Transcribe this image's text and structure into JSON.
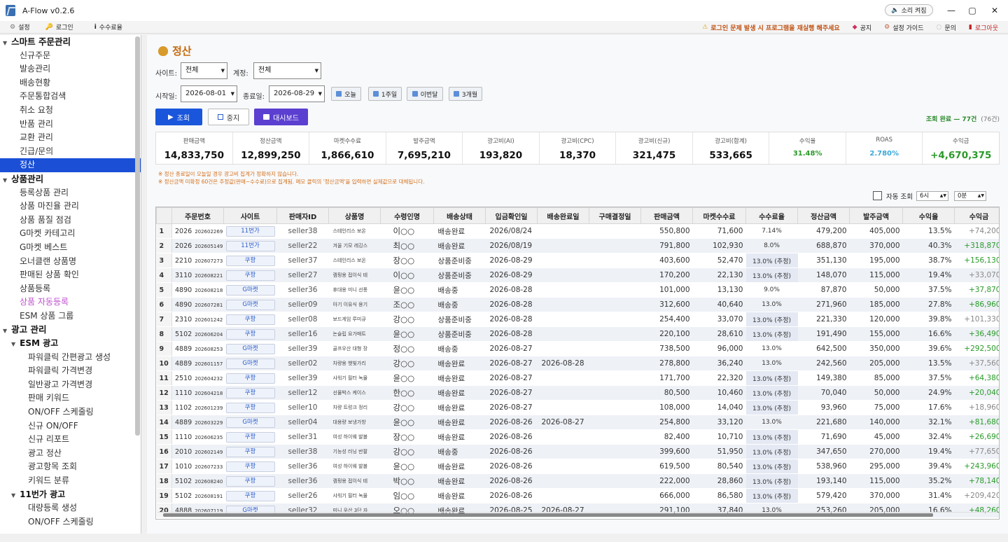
{
  "app": {
    "title": "A-Flow v0.2.6",
    "sound_label": "소리 켜짐"
  },
  "menubar": {
    "left": [
      {
        "icon": "gear-icon",
        "label": "설정"
      },
      {
        "icon": "key-icon",
        "label": "로그인"
      },
      {
        "icon": "info-icon",
        "label": "수수료율"
      }
    ],
    "right": [
      {
        "icon": "warning-icon",
        "label": "로그인 문제 발생 시 프로그램을 재실행 해주세요"
      },
      {
        "icon": "notice-icon",
        "label": "공지"
      },
      {
        "icon": "guide-icon",
        "label": "설정 가이드"
      },
      {
        "icon": "chat-icon",
        "label": "문의"
      },
      {
        "icon": "logout-icon",
        "label": "로그아웃"
      }
    ]
  },
  "sidebar": [
    {
      "level": "h1",
      "label": "스마트 주문관리"
    },
    {
      "level": "l1",
      "label": "신규주문"
    },
    {
      "level": "l1",
      "label": "발송관리"
    },
    {
      "level": "l1",
      "label": "배송현황"
    },
    {
      "level": "l1",
      "label": "주문통합검색"
    },
    {
      "level": "l1",
      "label": "취소 요청"
    },
    {
      "level": "l1",
      "label": "반품 관리"
    },
    {
      "level": "l1",
      "label": "교환 관리"
    },
    {
      "level": "l1",
      "label": "긴급/문의"
    },
    {
      "level": "l1",
      "label": "정산",
      "active": true
    },
    {
      "level": "h1",
      "label": "상품관리"
    },
    {
      "level": "l1",
      "label": "등록상품 관리"
    },
    {
      "level": "l1",
      "label": "상품 마진율 관리"
    },
    {
      "level": "l1",
      "label": "상품 품질 점검"
    },
    {
      "level": "l1",
      "label": "G마켓 카테고리"
    },
    {
      "level": "l1",
      "label": "G마켓 베스트"
    },
    {
      "level": "l1",
      "label": "오너클랜 상품명"
    },
    {
      "level": "l1",
      "label": "판매된 상품 확인"
    },
    {
      "level": "l1",
      "label": "상품등록"
    },
    {
      "level": "l1",
      "label": "상품 자동등록",
      "pink": true
    },
    {
      "level": "l1",
      "label": "ESM 상품 그룹"
    },
    {
      "level": "h1",
      "label": "광고 관리"
    },
    {
      "level": "h2",
      "label": "ESM 광고"
    },
    {
      "level": "l2",
      "label": "파워클릭 간편광고 생성"
    },
    {
      "level": "l2",
      "label": "파워클릭 가격변경"
    },
    {
      "level": "l2",
      "label": "일반광고 가격변경"
    },
    {
      "level": "l2",
      "label": "판매 키워드"
    },
    {
      "level": "l2",
      "label": "ON/OFF 스케줄링"
    },
    {
      "level": "l2",
      "label": "신규 ON/OFF"
    },
    {
      "level": "l2",
      "label": "신규 리포트"
    },
    {
      "level": "l2",
      "label": "광고 정산"
    },
    {
      "level": "l2",
      "label": "광고항목 조회"
    },
    {
      "level": "l2",
      "label": "키워드 분류"
    },
    {
      "level": "h2",
      "label": "11번가 광고"
    },
    {
      "level": "l2",
      "label": "대량등록 생성"
    },
    {
      "level": "l2",
      "label": "ON/OFF 스케줄링"
    }
  ],
  "page": {
    "title": "정산"
  },
  "filters": {
    "site_label": "사이트:",
    "site_value": "전체",
    "account_label": "계정:",
    "account_value": "전체",
    "start_label": "시작일:",
    "start_value": "2026-08-01",
    "end_label": "종료일:",
    "end_value": "2026-08-29",
    "quick": [
      "오늘",
      "1주일",
      "이번달",
      "3개월"
    ]
  },
  "actions": {
    "search": "조회",
    "stop": "중지",
    "dashboard": "대시보드"
  },
  "status": {
    "text": "조회 완료 — 77건",
    "count": "(76건)"
  },
  "summary": [
    {
      "label": "판매금액",
      "value": "14,833,750"
    },
    {
      "label": "정산금액",
      "value": "12,899,250"
    },
    {
      "label": "마켓수수료",
      "value": "1,866,610"
    },
    {
      "label": "발주금액",
      "value": "7,695,210"
    },
    {
      "label": "광고비(AI)",
      "value": "193,820"
    },
    {
      "label": "광고비(CPC)",
      "value": "18,370"
    },
    {
      "label": "광고비(신규)",
      "value": "321,475"
    },
    {
      "label": "광고비(합계)",
      "value": "533,665"
    },
    {
      "label": "수익율",
      "value": "31.48%",
      "color": "#2a9a2a"
    },
    {
      "label": "ROAS",
      "value": "2.780%",
      "color": "#3aa8d8"
    },
    {
      "label": "수익금",
      "value": "+4,670,375",
      "color": "#2a9a2a"
    }
  ],
  "notes": [
    "※ 정산 종료일이 오늘일 경우 광고비 집계가 정확하지 않습니다.",
    "※ 정산금액 미확정 60건은 추정값(판매−수수료)으로 집계됨. 메모 클릭의 '정산금액'을 입력하면 실제값으로 대체됩니다."
  ],
  "auto": {
    "label": "자동 조회",
    "hour": "6시",
    "minute": "0분"
  },
  "table": {
    "columns": [
      "주문번호",
      "사이트",
      "판매자ID",
      "상품명",
      "수령인명",
      "배송상태",
      "입금확인일",
      "배송완료일",
      "구매결정일",
      "판매금액",
      "마켓수수료",
      "수수료율",
      "정산금액",
      "발주금액",
      "수익율",
      "수익금"
    ],
    "rows": [
      [
        "1",
        "2026",
        "202602269",
        "11번가",
        "seller38",
        "스테인리스 보온",
        "이○○",
        "배송완료",
        "2026/08/24",
        "",
        "",
        "550,800",
        "71,600",
        "7.14%",
        "479,200",
        "405,000",
        "13.5%",
        "+74,200"
      ],
      [
        "2",
        "2026",
        "202605149",
        "11번가",
        "seller22",
        "겨울 기모 레깅스",
        "최○○",
        "배송완료",
        "2026/08/19",
        "",
        "",
        "791,800",
        "102,930",
        "8.0%",
        "688,870",
        "370,000",
        "40.3%",
        "+318,870"
      ],
      [
        "3",
        "2210",
        "202607273",
        "쿠팡",
        "seller37",
        "스테인리스 보온",
        "장○○",
        "상품준비중",
        "2026-08-29",
        "",
        "",
        "403,600",
        "52,470",
        "13.0% (추정)",
        "351,130",
        "195,000",
        "38.7%",
        "+156,130"
      ],
      [
        "4",
        "3110",
        "202608221",
        "쿠팡",
        "seller27",
        "캠핑용 접이식 테",
        "이○○",
        "상품준비중",
        "2026-08-29",
        "",
        "",
        "170,200",
        "22,130",
        "13.0% (추정)",
        "148,070",
        "115,000",
        "19.4%",
        "+33,070"
      ],
      [
        "5",
        "4890",
        "202608218",
        "G마켓",
        "seller36",
        "휴대용 미니 선풍",
        "윤○○",
        "배송중",
        "2026-08-28",
        "",
        "",
        "101,000",
        "13,130",
        "9.0%",
        "87,870",
        "50,000",
        "37.5%",
        "+37,870"
      ],
      [
        "6",
        "4890",
        "202607281",
        "G마켓",
        "seller09",
        "아기 이유식 용기",
        "조○○",
        "배송중",
        "2026-08-28",
        "",
        "",
        "312,600",
        "40,640",
        "13.0%",
        "271,960",
        "185,000",
        "27.8%",
        "+86,960"
      ],
      [
        "7",
        "2310",
        "202601242",
        "쿠팡",
        "seller08",
        "보드게임 루미큐",
        "강○○",
        "상품준비중",
        "2026-08-28",
        "",
        "",
        "254,400",
        "33,070",
        "13.0% (추정)",
        "221,330",
        "120,000",
        "39.8%",
        "+101,330"
      ],
      [
        "8",
        "5102",
        "202606204",
        "쿠팡",
        "seller16",
        "논슬립 요가매트",
        "윤○○",
        "상품준비중",
        "2026-08-28",
        "",
        "",
        "220,100",
        "28,610",
        "13.0% (추정)",
        "191,490",
        "155,000",
        "16.6%",
        "+36,490"
      ],
      [
        "9",
        "4889",
        "202608253",
        "G마켓",
        "seller39",
        "골프우산 대형 장",
        "정○○",
        "배송중",
        "2026-08-27",
        "",
        "",
        "738,500",
        "96,000",
        "13.0%",
        "642,500",
        "350,000",
        "39.6%",
        "+292,500"
      ],
      [
        "10",
        "4889",
        "202601157",
        "G마켓",
        "seller02",
        "차량용 햇빛가리",
        "강○○",
        "배송완료",
        "2026-08-27",
        "2026-08-28",
        "",
        "278,800",
        "36,240",
        "13.0%",
        "242,560",
        "205,000",
        "13.5%",
        "+37,560"
      ],
      [
        "11",
        "2510",
        "202604232",
        "쿠팡",
        "seller39",
        "샤워기 필터 녹물",
        "윤○○",
        "배송완료",
        "2026-08-27",
        "",
        "",
        "171,700",
        "22,320",
        "13.0% (추정)",
        "149,380",
        "85,000",
        "37.5%",
        "+64,380"
      ],
      [
        "12",
        "1110",
        "202604218",
        "쿠팡",
        "seller12",
        "선물박스 케이스",
        "한○○",
        "배송완료",
        "2026-08-27",
        "",
        "",
        "80,500",
        "10,460",
        "13.0% (추정)",
        "70,040",
        "50,000",
        "24.9%",
        "+20,040"
      ],
      [
        "13",
        "1102",
        "202601239",
        "쿠팡",
        "seller10",
        "차량 트렁크 정리",
        "강○○",
        "배송완료",
        "2026-08-27",
        "",
        "",
        "108,000",
        "14,040",
        "13.0% (추정)",
        "93,960",
        "75,000",
        "17.6%",
        "+18,960"
      ],
      [
        "14",
        "4889",
        "202603229",
        "G마켓",
        "seller04",
        "대용량 보냉가방",
        "윤○○",
        "배송완료",
        "2026-08-26",
        "2026-08-27",
        "",
        "254,800",
        "33,120",
        "13.0%",
        "221,680",
        "140,000",
        "32.1%",
        "+81,680"
      ],
      [
        "15",
        "1110",
        "202606235",
        "쿠팡",
        "seller31",
        "여성 하이웨 발볼",
        "장○○",
        "배송완료",
        "2026-08-26",
        "",
        "",
        "82,400",
        "10,710",
        "13.0% (추정)",
        "71,690",
        "45,000",
        "32.4%",
        "+26,690"
      ],
      [
        "16",
        "2010",
        "202602149",
        "쿠팡",
        "seller38",
        "기능성 러닝 반팔",
        "강○○",
        "배송중",
        "2026-08-26",
        "",
        "",
        "399,600",
        "51,950",
        "13.0% (추정)",
        "347,650",
        "270,000",
        "19.4%",
        "+77,650"
      ],
      [
        "17",
        "1010",
        "202607233",
        "쿠팡",
        "seller36",
        "여성 하이웨 발볼",
        "윤○○",
        "배송완료",
        "2026-08-26",
        "",
        "",
        "619,500",
        "80,540",
        "13.0% (추정)",
        "538,960",
        "295,000",
        "39.4%",
        "+243,960"
      ],
      [
        "18",
        "5102",
        "202608240",
        "쿠팡",
        "seller36",
        "캠핑용 접이식 테",
        "박○○",
        "배송완료",
        "2026-08-26",
        "",
        "",
        "222,000",
        "28,860",
        "13.0% (추정)",
        "193,140",
        "115,000",
        "35.2%",
        "+78,140"
      ],
      [
        "19",
        "5102",
        "202608191",
        "쿠팡",
        "seller26",
        "샤워기 필터 녹물",
        "임○○",
        "배송완료",
        "2026-08-26",
        "",
        "",
        "666,000",
        "86,580",
        "13.0% (추정)",
        "579,420",
        "370,000",
        "31.4%",
        "+209,420"
      ],
      [
        "20",
        "4888",
        "202607119",
        "G마켓",
        "seller32",
        "미니 우산 3단 자",
        "오○○",
        "배송완료",
        "2026-08-25",
        "2026-08-27",
        "",
        "291,100",
        "37,840",
        "13.0%",
        "253,260",
        "205,000",
        "16.6%",
        "+48,260"
      ]
    ]
  }
}
